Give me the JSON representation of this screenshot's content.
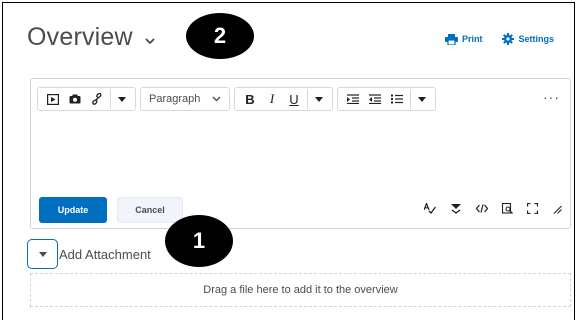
{
  "header": {
    "title": "Overview",
    "print_label": "Print",
    "settings_label": "Settings"
  },
  "badges": {
    "one": "1",
    "two": "2"
  },
  "toolbar": {
    "paragraph_label": "Paragraph",
    "bold": "B",
    "italic": "I",
    "underline": "U",
    "more": "···"
  },
  "actions": {
    "update_label": "Update",
    "cancel_label": "Cancel"
  },
  "attachments": {
    "add_label": "Add Attachment",
    "dropzone_text": "Drag a file here to add it to the overview"
  },
  "colors": {
    "accent": "#006fbf",
    "text": "#494c4e",
    "border": "#cdd5dc"
  }
}
